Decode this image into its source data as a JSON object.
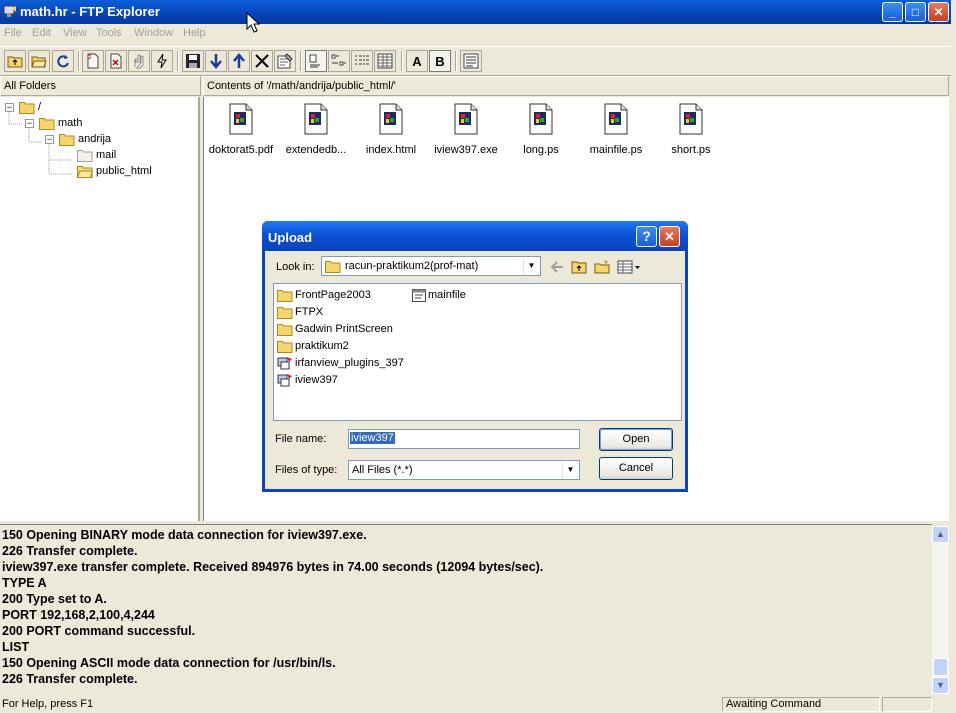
{
  "window": {
    "title": "math.hr - FTP Explorer",
    "controls": {
      "minimize": "_",
      "maximize": "□",
      "close": "✕"
    }
  },
  "menu": [
    "File",
    "Edit",
    "View",
    "Tools",
    "Window",
    "Help"
  ],
  "toolbar": {
    "text_buttons": {
      "a": "A",
      "b": "B"
    }
  },
  "folders_pane": {
    "header": "All Folders",
    "tree": [
      {
        "label": "/",
        "level": 0,
        "expander": "−"
      },
      {
        "label": "math",
        "level": 1,
        "expander": "−"
      },
      {
        "label": "andrija",
        "level": 2,
        "expander": "−"
      },
      {
        "label": "mail",
        "level": 3,
        "expander": ""
      },
      {
        "label": "public_html",
        "level": 3,
        "expander": "",
        "open": true
      }
    ]
  },
  "contents_pane": {
    "header": "Contents of '/math/andrija/public_html/'",
    "files": [
      "doktorat5.pdf",
      "extendedb...",
      "index.html",
      "iview397.exe",
      "long.ps",
      "mainfile.ps",
      "short.ps"
    ]
  },
  "dialog": {
    "title": "Upload",
    "help": "?",
    "close": "✕",
    "look_in_label": "Look in:",
    "look_in_value": "racun-praktikum2(prof-mat)",
    "items": [
      {
        "name": "FrontPage2003",
        "kind": "folder"
      },
      {
        "name": "FTPX",
        "kind": "folder"
      },
      {
        "name": "Gadwin PrintScreen",
        "kind": "folder"
      },
      {
        "name": "praktikum2",
        "kind": "folder"
      },
      {
        "name": "irfanview_plugins_397",
        "kind": "exe"
      },
      {
        "name": "iview397",
        "kind": "exe"
      },
      {
        "name": "mainfile",
        "kind": "file"
      }
    ],
    "file_name_label": "File name:",
    "file_name_value": "iview397",
    "files_of_type_label": "Files of type:",
    "files_of_type_value": "All Files (*.*)",
    "open_button": "Open",
    "cancel_button": "Cancel"
  },
  "log": [
    "150 Opening BINARY mode data connection for iview397.exe.",
    "226 Transfer complete.",
    "iview397.exe transfer complete.  Received 894976 bytes in 74.00 seconds (12094 bytes/sec).",
    "TYPE A",
    "200 Type set to A.",
    "PORT 192,168,2,100,4,244",
    "200 PORT command successful.",
    "LIST",
    "150 Opening ASCII mode data connection for /usr/bin/ls.",
    "226 Transfer complete."
  ],
  "status": {
    "help": "For Help, press F1",
    "state": "Awaiting Command"
  },
  "colors": {
    "titlebar": "#0a5fd8",
    "face": "#ece9d8",
    "selection": "#316ac5",
    "folder": "#f5d66b"
  }
}
